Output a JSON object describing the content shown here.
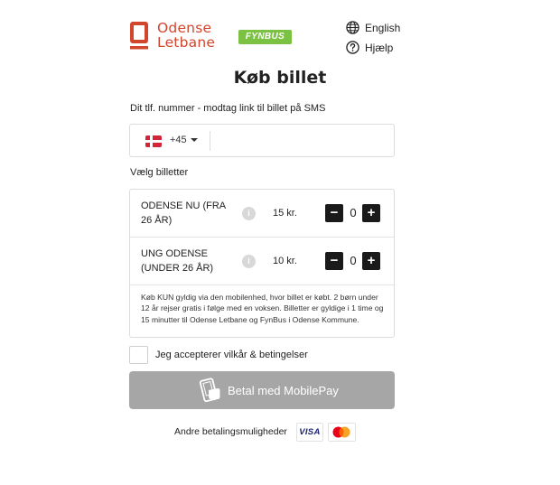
{
  "header": {
    "brand_line1": "Odense",
    "brand_line2": "Letbane",
    "partner_logo": "FYNBUS",
    "language_link": "English",
    "help_link": "Hjælp",
    "icons": {
      "language": "globe-icon",
      "help": "question-circle-icon"
    }
  },
  "page_title": "Køb billet",
  "phone": {
    "label": "Dit tlf. nummer - modtag link til billet på SMS",
    "country_code": "+45",
    "country_flag": "denmark-flag",
    "value": "",
    "placeholder": ""
  },
  "tickets": {
    "label": "Vælg billetter",
    "items": [
      {
        "name": "ODENSE NU (FRA 26 ÅR)",
        "info": "i",
        "price": "15 kr.",
        "quantity": "0",
        "minus": "−",
        "plus": "+"
      },
      {
        "name": "UNG ODENSE (UNDER 26 ÅR)",
        "info": "i",
        "price": "10 kr.",
        "quantity": "0",
        "minus": "−",
        "plus": "+"
      }
    ],
    "description": "Køb KUN gyldig via den mobilenhed, hvor billet er købt. 2 børn under 12 år rejser gratis i følge med en voksen. Billetter er gyldige i 1 time og 15 minutter til Odense Letbane og FynBus i Odense Kommune."
  },
  "terms": {
    "prefix": "Jeg accepterer ",
    "link": "vilkår & betingelser",
    "checked": false
  },
  "payment": {
    "button_label": "Betal med MobilePay",
    "other_label": "Andre betalingsmuligheder",
    "cards": [
      "VISA",
      "Mastercard"
    ],
    "icon": "mobilepay-icon"
  },
  "colors": {
    "brand": "#d2462e",
    "fynbus": "#7bc142",
    "pay_button_disabled": "#a6a6a6",
    "stepper": "#1a1a1a"
  }
}
